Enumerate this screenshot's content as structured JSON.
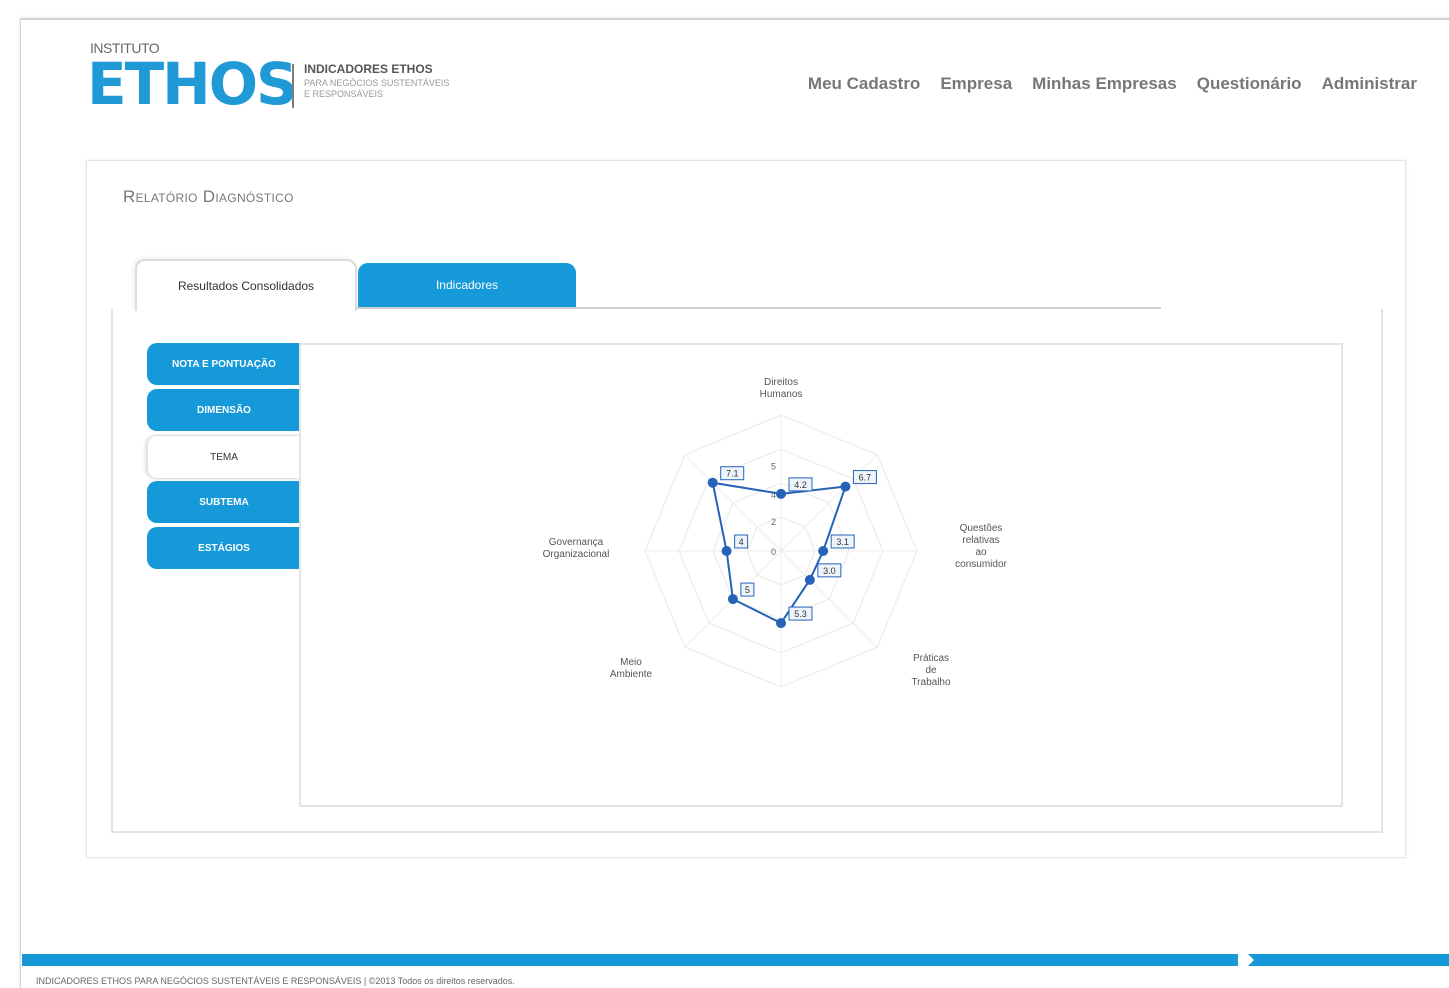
{
  "logo": {
    "top_text": "INSTITUTO",
    "main_text": "ETHOS",
    "sub_title": "INDICADORES ETHOS",
    "sub_line1": "PARA NEGÓCIOS SUSTENTÁVEIS",
    "sub_line2": "E RESPONSÁVEIS",
    "color": "#1f9ad6"
  },
  "nav": {
    "items": [
      "Meu Cadastro",
      "Empresa",
      "Minhas Empresas",
      "Questionário",
      "Administrar"
    ]
  },
  "report": {
    "title": "Relatório Diagnóstico",
    "tabs": [
      {
        "label": "Resultados Consolidados",
        "active": true
      },
      {
        "label": "Indicadores",
        "active": false
      }
    ],
    "side_menu": [
      {
        "label": "NOTA E PONTUAÇÃO",
        "active": false
      },
      {
        "label": "DIMENSÃO",
        "active": false
      },
      {
        "label": "TEMA",
        "active": true
      },
      {
        "label": "SUBTEMA",
        "active": false
      },
      {
        "label": "ESTÁGIOS",
        "active": false
      }
    ]
  },
  "chart_data": {
    "type": "radar",
    "categories": [
      "Direitos Humanos",
      "",
      "Questões relativas ao consumidor",
      "",
      "Práticas de Trabalho",
      "",
      "Meio Ambiente",
      "Governança Organizacional"
    ],
    "values": [
      4.2,
      6.7,
      3.1,
      3.0,
      5.3,
      5.0,
      4.0,
      7.1
    ],
    "value_labels": [
      "4.2",
      "6.7",
      "3.1",
      "3.0",
      "5.3",
      "5",
      "4",
      "7.1"
    ],
    "radial_ticks": [
      "0",
      "2",
      "4",
      "5"
    ],
    "series_color": "#2563b8",
    "grid_color": "#ececec"
  },
  "footer": {
    "text": "INDICADORES ETHOS PARA NEGÓCIOS SUSTENTÁVEIS E RESPONSÁVEIS | ©2013 Todos os direitos reservados.",
    "bar_color": "#1599d8"
  }
}
